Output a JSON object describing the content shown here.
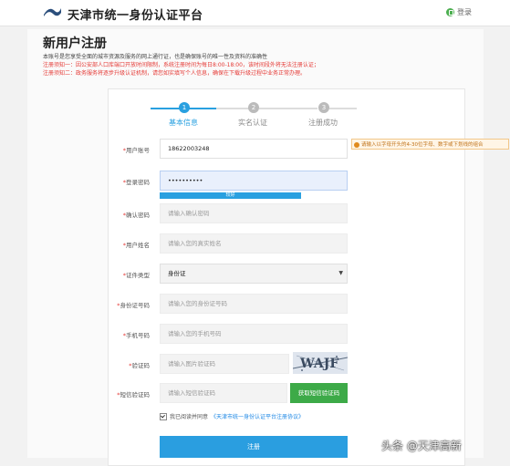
{
  "header": {
    "site_title": "天津市统一身份认证平台",
    "login_label": "登录"
  },
  "page": {
    "title": "新用户注册",
    "notes": [
      {
        "text": "本账号是您享受全面的城市资源及服务的网上通行证，也是确保账号的唯一性及资料的准确性",
        "color": "black"
      },
      {
        "text": "注册须知一：因公安部人口库端口开放时间限制，系统注册时间为每日8:00-18:00，该时间段外将无法注册认证；",
        "color": "red"
      },
      {
        "text": "注册须知二：政务服务将逐步升级认证机制，请您如实填写个人信息，确保在下载升级过程中业务正常办理。",
        "color": "red"
      }
    ]
  },
  "steps": [
    {
      "num": "1",
      "label": "基本信息",
      "active": true
    },
    {
      "num": "2",
      "label": "实名认证",
      "active": false
    },
    {
      "num": "3",
      "label": "注册成功",
      "active": false
    }
  ],
  "form": {
    "username": {
      "label": "用户账号",
      "value": "18622003248"
    },
    "password": {
      "label": "登录密码",
      "value": "••••••••••",
      "strength": "较好"
    },
    "confirm": {
      "label": "确认密码",
      "placeholder": "请输入确认密码"
    },
    "realname": {
      "label": "用户姓名",
      "placeholder": "请输入您的真实姓名"
    },
    "idtype": {
      "label": "证件类型",
      "value": "身份证"
    },
    "idnum": {
      "label": "身份证号码",
      "placeholder": "请输入您的身份证号码"
    },
    "phone": {
      "label": "手机号码",
      "placeholder": "请输入您的手机号码"
    },
    "captcha": {
      "label": "验证码",
      "placeholder": "请输入图片验证码",
      "image_text": "WAJF"
    },
    "sms": {
      "label": "短信验证码",
      "placeholder": "请输入短信验证码",
      "button": "获取短信验证码"
    },
    "agree_prefix": "我已阅读并同意",
    "agree_link": "《天津市统一身份认证平台注册协议》",
    "submit": "注册"
  },
  "tooltip": "请输入以字母开头的4-30位字母、数字或下划线的组合",
  "watermark": "头条 @天津高新",
  "colors": {
    "accent": "#29a0e0",
    "sms_button": "#3daa48",
    "warning": "#e53935"
  }
}
